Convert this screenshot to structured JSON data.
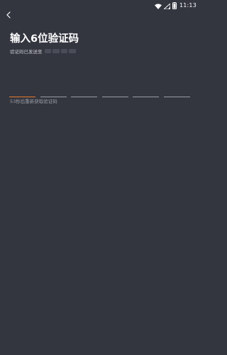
{
  "status_bar": {
    "time": "11:13",
    "icons": [
      "wifi-icon",
      "signal-icon",
      "battery-icon"
    ]
  },
  "header": {
    "back_icon": "chevron-left-icon"
  },
  "main": {
    "title": "输入6位验证码",
    "sent_to_label": "验证码已发送至",
    "code_slots": [
      "",
      "",
      "",
      "",
      "",
      ""
    ],
    "active_slot_index": 0,
    "resend_text": "53秒后重新获取验证码"
  },
  "colors": {
    "background": "#33353f",
    "accent": "#e87b2e",
    "slot_line": "#9b9da5",
    "text_primary": "#ffffff",
    "text_secondary": "#c9cad0",
    "text_muted": "#9c9ea7"
  }
}
